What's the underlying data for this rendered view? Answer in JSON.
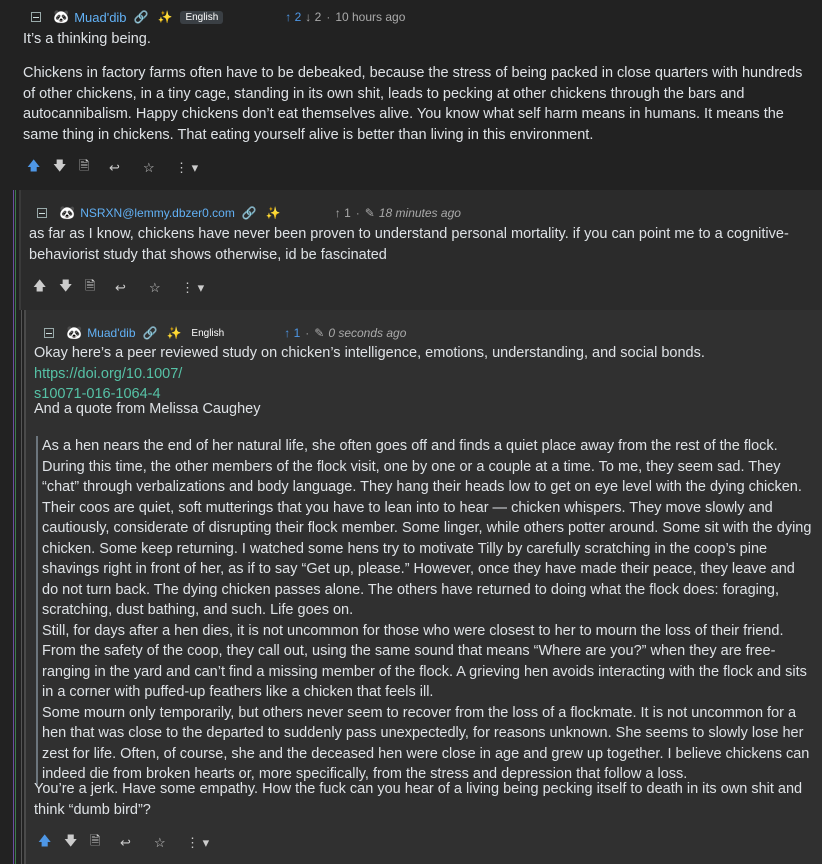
{
  "comments": [
    {
      "username": "Muad'dib",
      "language": "English",
      "upvotes": "2",
      "downvotes": "2",
      "time": "10 hours ago",
      "paragraphs": [
        "It’s a thinking being.",
        "Chickens in factory farms often have to be debeaked, because the stress of being packed in close quarters with hundreds of other chickens, in a tiny cage, standing in its own shit, leads to pecking at other chickens through the bars and autocannibalism. Happy chickens don’t eat themselves alive. You know what self harm means in humans. It means the same thing in chickens. That eating yourself alive is better than living in this environment."
      ]
    },
    {
      "username": "NSRXN@lemmy.dbzer0.com",
      "upvotes": "1",
      "time": "18 minutes ago",
      "paragraphs": [
        "as far as I know, chickens have never been proven to understand personal mortality. if you can point me to a cognitive-behaviorist study that shows otherwise, id be fascinated"
      ]
    },
    {
      "username": "Muad'dib",
      "language": "English",
      "upvotes": "1",
      "time": "0 seconds ago",
      "intro": "Okay here’s a peer reviewed study on chicken’s intelligence, emotions, understanding, and social bonds.",
      "link_line1": "https://doi.org/10.1007/",
      "link_line2": "s10071-016-1064-4",
      "quote_intro": "And a quote from Melissa Caughey",
      "quote": [
        "As a hen nears the end of her natural life, she often goes off and finds a quiet place away from the rest of the flock. During this time, the other members of the flock visit, one by one or a couple at a time. To me, they seem sad. They “chat” through verbalizations and body language. They hang their heads low to get on eye level with the dying chicken. Their coos are quiet, soft mutterings that you have to lean into to hear — chicken whispers. They move slowly and cautiously, considerate of disrupting their flock member. Some linger, while others potter around. Some sit with the dying chicken. Some keep returning. I watched some hens try to motivate Tilly by carefully scratching in the coop’s pine shavings right in front of her, as if to say “Get up, please.” However, once they have made their peace, they leave and do not turn back. The dying chicken passes alone. The others have returned to doing what the flock does: foraging, scratching, dust bathing, and such. Life goes on.",
        "Still, for days after a hen dies, it is not uncommon for those who were closest to her to mourn the loss of their friend. From the safety of the coop, they call out, using the same sound that means “Where are you?” when they are free-ranging in the yard and can’t find a missing member of the flock. A grieving hen avoids interacting with the flock and sits in a corner with puffed-up feathers like a chicken that feels ill.",
        "Some mourn only temporarily, but others never seem to recover from the loss of a flockmate. It is not uncommon for a hen that was close to the departed to suddenly pass unexpectedly, for reasons unknown. She seems to slowly lose her zest for life. Often, of course, she and the deceased hen were close in age and grew up together. I believe chickens can indeed die from broken hearts or, more specifically, from the stress and depression that follow a loss."
      ],
      "closing": "You’re a jerk. Have some empathy. How the fuck can you hear of a living being pecking itself to death in its own shit and think “dumb bird”?"
    }
  ],
  "icons": {
    "collapse": "collapse-icon",
    "avatar": "avatar-icon",
    "link": "link-icon",
    "instance": "instance-star-icon",
    "upvote": "arrow-up-icon",
    "downvote": "arrow-down-icon",
    "edit": "pencil-icon",
    "source": "document-icon",
    "reply": "reply-icon",
    "save": "star-icon",
    "more": "more-icon"
  },
  "colors": {
    "background": "#222222",
    "nested_bg_1": "#2b2b2b",
    "nested_bg_2": "#303030",
    "username": "#62b1f5",
    "link": "#56c2a6",
    "upvote_active": "#4e97e6"
  }
}
